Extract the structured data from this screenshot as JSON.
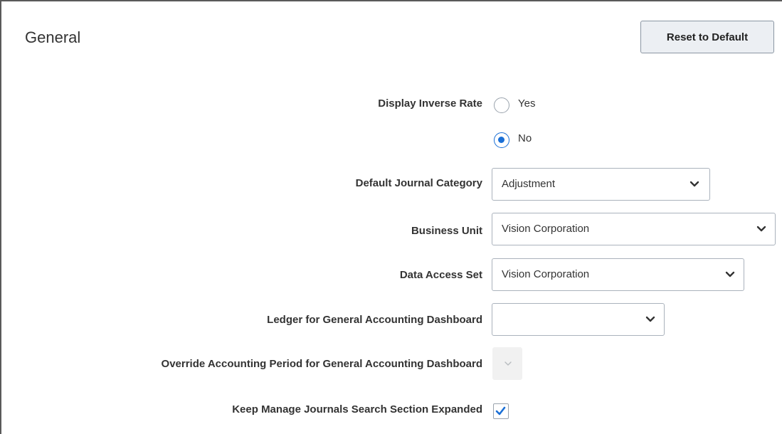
{
  "section": {
    "title": "General",
    "reset_label": "Reset to Default"
  },
  "display_inverse_rate": {
    "label": "Display Inverse Rate",
    "options": [
      "Yes",
      "No"
    ],
    "selected": "No"
  },
  "default_journal_category": {
    "label": "Default Journal Category",
    "value": "Adjustment"
  },
  "business_unit": {
    "label": "Business Unit",
    "value": "Vision Corporation"
  },
  "data_access_set": {
    "label": "Data Access Set",
    "value": "Vision Corporation"
  },
  "ledger_dashboard": {
    "label": "Ledger for General Accounting Dashboard",
    "value": ""
  },
  "override_period": {
    "label": "Override Accounting Period for General Accounting Dashboard",
    "value": "",
    "disabled": true
  },
  "keep_search_expanded": {
    "label": "Keep Manage Journals Search Section Expanded",
    "checked": true
  },
  "icons": {
    "dropdown": "chevron-down-icon",
    "checkbox": "checkmark-icon"
  },
  "colors": {
    "accent": "#1a6fd6",
    "label_text": "#333333",
    "button_bg": "#eceff3"
  }
}
